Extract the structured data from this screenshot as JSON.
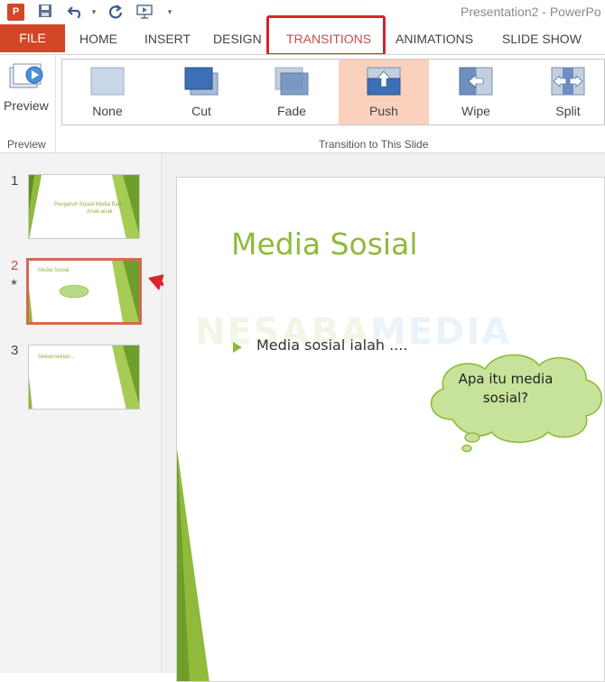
{
  "app": {
    "logo_letter": "P",
    "window_title": "Presentation2 - PowerPo"
  },
  "qat": {
    "icons": [
      "save-icon",
      "undo-icon",
      "redo-icon",
      "start-from-beginning-icon",
      "customize-qat-icon"
    ]
  },
  "tabs": {
    "file": "FILE",
    "home": "HOME",
    "insert": "INSERT",
    "design": "DESIGN",
    "transitions": "TRANSITIONS",
    "animations": "ANIMATIONS",
    "slideshow": "SLIDE SHOW"
  },
  "ribbon": {
    "preview_label": "Preview",
    "preview_group_label": "Preview",
    "transition_group_label": "Transition to This Slide",
    "transitions": [
      {
        "label": "None",
        "icon": "none-transition-icon",
        "selected": false
      },
      {
        "label": "Cut",
        "icon": "cut-transition-icon",
        "selected": false
      },
      {
        "label": "Fade",
        "icon": "fade-transition-icon",
        "selected": false
      },
      {
        "label": "Push",
        "icon": "push-transition-icon",
        "selected": true
      },
      {
        "label": "Wipe",
        "icon": "wipe-transition-icon",
        "selected": false
      },
      {
        "label": "Split",
        "icon": "split-transition-icon",
        "selected": false
      }
    ]
  },
  "slides_panel": {
    "slides": [
      {
        "number": "1",
        "thumb_title": "Pengaruh Sosial Media Bagi",
        "thumb_subtitle": "Anak-anak"
      },
      {
        "number": "2",
        "thumb_title": "Media Sosial",
        "thumb_subtitle": ""
      },
      {
        "number": "3",
        "thumb_title": "Sekiansekian...",
        "thumb_subtitle": ""
      }
    ],
    "active_index": 1,
    "transition_star": "★"
  },
  "slide": {
    "title": "Media Sosial",
    "bullet": "Media sosial ialah ....",
    "callout": "Apa itu media sosial?",
    "watermark_part1": "NESABA",
    "watermark_part2": "MEDIA"
  },
  "colors": {
    "accent": "#d24726",
    "green": "#8fba3b",
    "highlight": "#d9232d",
    "selected_transition_bg": "#fbd1bd"
  }
}
